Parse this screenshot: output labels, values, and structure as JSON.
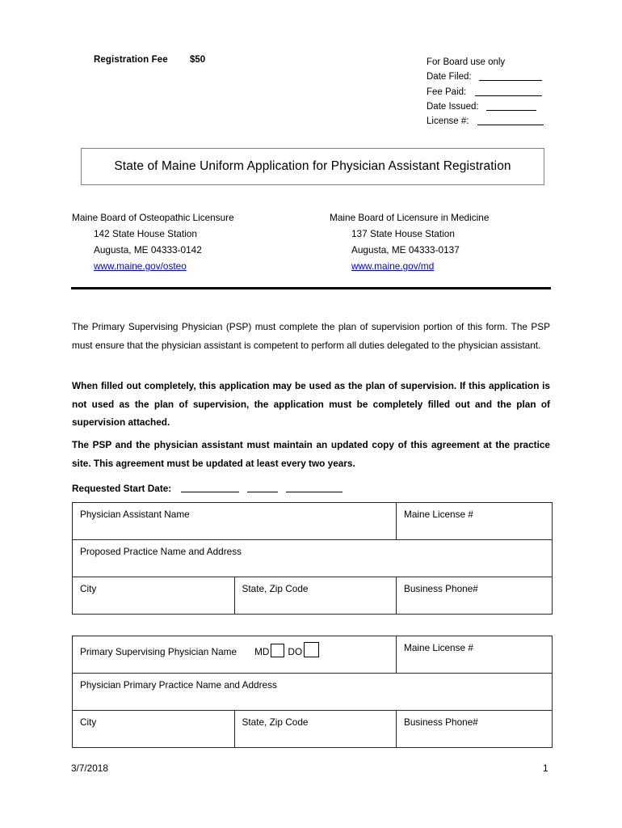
{
  "header": {
    "registration_fee_label": "Registration Fee",
    "registration_fee_amount": "$50",
    "board_use": {
      "heading": "For Board use only",
      "rows": [
        {
          "label": "Date Filed:",
          "blank_width": 78
        },
        {
          "label": "Fee Paid:",
          "blank_width": 83
        },
        {
          "label": "Date Issued:",
          "blank_width": 62
        },
        {
          "label": "License #:",
          "blank_width": 82
        }
      ]
    }
  },
  "title": {
    "text": "State of Maine Uniform Application for Physician Assistant Registration"
  },
  "boards": {
    "left": {
      "name": "Maine Board of Osteopathic Licensure",
      "station": "142 State House Station",
      "city_state_zip": "Augusta, ME 04333-0142",
      "website": "www.maine.gov/osteo"
    },
    "right": {
      "name": "Maine Board of Licensure in Medicine",
      "station": "137 State House Station",
      "city_state_zip": "Augusta, ME 04333-0137",
      "website": "www.maine.gov/md"
    }
  },
  "instructions": {
    "paragraph_1": "The Primary Supervising Physician (PSP) must complete the plan of supervision portion of this form.  The PSP must ensure that the physician assistant is competent to perform all duties delegated to the physician assistant.",
    "paragraph_2": "When filled out completely, this application may be used as the plan of supervision.  If this application is not used as the plan of supervision, the application must be completely filled out and the plan of supervision attached.",
    "paragraph_3": "The PSP and the physician assistant must maintain an updated copy of this agreement at the practice site.  This agreement must be updated at least every two years."
  },
  "requested_start_date": {
    "label": "Requested Start Date:",
    "blanks": [
      72,
      38,
      70
    ]
  },
  "pa_table": {
    "name_label": "Physician Assistant Name",
    "license_label": "Maine License #",
    "practice_label": "Proposed Practice Name and Address",
    "city_label": "City",
    "state_zip_label": "State, Zip Code",
    "phone_label": "Business Phone#"
  },
  "psp_table": {
    "name_label": "Primary Supervising Physician Name",
    "degree_md_label": "MD",
    "degree_do_label": "DO",
    "license_label": "Maine License #",
    "practice_label": "Physician Primary Practice Name and Address",
    "city_label": "City",
    "state_zip_label": "State, Zip Code",
    "phone_label": "Business Phone#"
  },
  "footer": {
    "date": "3/7/2018",
    "page_number": "1"
  },
  "colors": {
    "link": "#0000ee",
    "title_border": "#808080",
    "table_border": "#262626",
    "text": "#000000"
  }
}
